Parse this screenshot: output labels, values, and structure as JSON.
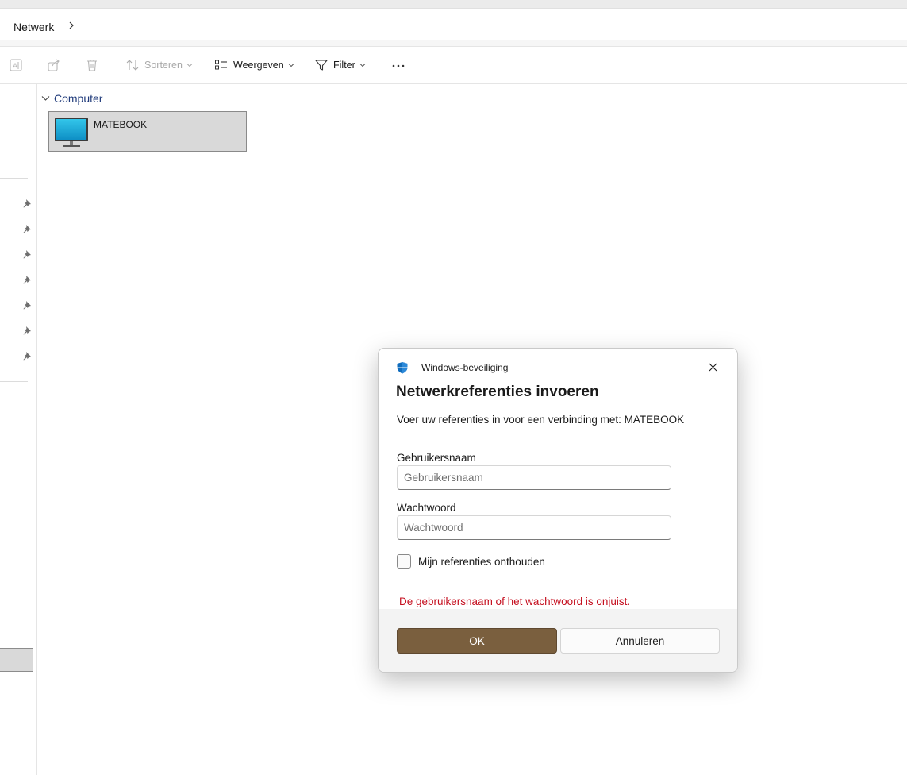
{
  "address_bar": {
    "crumb": "Netwerk"
  },
  "toolbar": {
    "sort_label": "Sorteren",
    "view_label": "Weergeven",
    "filter_label": "Filter"
  },
  "content": {
    "group_title": "Computer",
    "items": [
      {
        "name": "MATEBOOK"
      }
    ]
  },
  "dialog": {
    "app_name": "Windows-beveiliging",
    "heading": "Netwerkreferenties invoeren",
    "description": "Voer uw referenties in voor een verbinding met: MATEBOOK",
    "username_label": "Gebruikersnaam",
    "username_placeholder": "Gebruikersnaam",
    "password_label": "Wachtwoord",
    "password_placeholder": "Wachtwoord",
    "remember_label": "Mijn referenties onthouden",
    "error_text": "De gebruikersnaam of het wachtwoord is onjuist.",
    "ok_label": "OK",
    "cancel_label": "Annuleren"
  },
  "colors": {
    "accent_button": "#7a5f3e",
    "error_text": "#c50f1f",
    "group_title": "#1f3a7a",
    "shield": "#0f6cbd"
  }
}
